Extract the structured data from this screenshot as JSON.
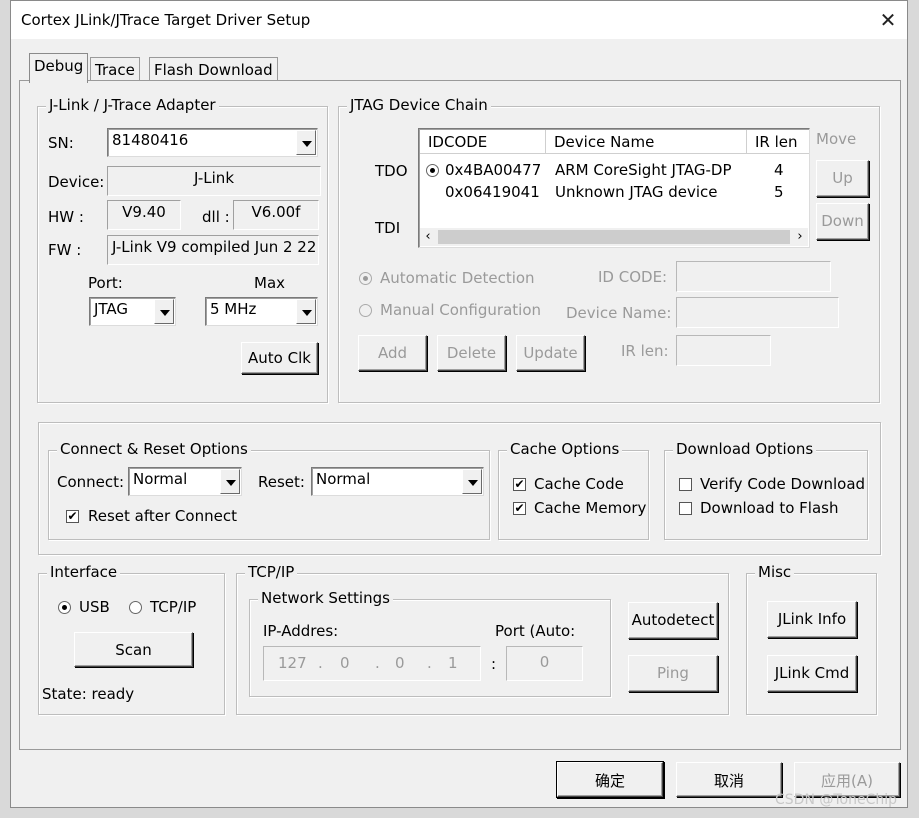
{
  "window": {
    "title": "Cortex JLink/JTrace Target Driver Setup"
  },
  "tabs": [
    "Debug",
    "Trace",
    "Flash Download"
  ],
  "adapter": {
    "group_title": "J-Link / J-Trace Adapter",
    "sn_label": "SN:",
    "sn_value": "81480416",
    "device_label": "Device:",
    "device_value": "J-Link",
    "hw_label": "HW :",
    "hw_value": "V9.40",
    "dll_label": "dll :",
    "dll_value": "V6.00f",
    "fw_label": "FW :",
    "fw_value": "J-Link V9 compiled Jun  2 22",
    "port_label": "Port:",
    "port_value": "JTAG",
    "max_label": "Max",
    "max_value": "5 MHz",
    "auto_clk": "Auto Clk"
  },
  "jtag": {
    "group_title": "JTAG Device Chain",
    "columns": [
      "IDCODE",
      "Device Name",
      "IR len"
    ],
    "rows": [
      {
        "idcode": "0x4BA00477",
        "name": "ARM CoreSight JTAG-DP",
        "irlen": "4"
      },
      {
        "idcode": "0x06419041",
        "name": "Unknown JTAG device",
        "irlen": "5"
      }
    ],
    "tdo": "TDO",
    "tdi": "TDI",
    "move_label": "Move",
    "up": "Up",
    "down": "Down",
    "auto_detect": "Automatic Detection",
    "manual_config": "Manual Configuration",
    "idcode_label": "ID CODE:",
    "devname_label": "Device Name:",
    "irlen_label": "IR len:",
    "add": "Add",
    "delete": "Delete",
    "update": "Update"
  },
  "connect": {
    "group_title": "Connect & Reset Options",
    "connect_label": "Connect:",
    "connect_value": "Normal",
    "reset_label": "Reset:",
    "reset_value": "Normal",
    "reset_after_connect": "Reset after Connect"
  },
  "cache": {
    "group_title": "Cache Options",
    "cache_code": "Cache Code",
    "cache_memory": "Cache Memory"
  },
  "download": {
    "group_title": "Download Options",
    "verify": "Verify Code Download",
    "to_flash": "Download to Flash"
  },
  "interface": {
    "group_title": "Interface",
    "usb": "USB",
    "tcpip": "TCP/IP",
    "scan": "Scan",
    "state": "State: ready"
  },
  "tcpip": {
    "group_title": "TCP/IP",
    "network_title": "Network Settings",
    "ip_label": "IP-Addres:",
    "ip": [
      "127",
      "0",
      "0",
      "1"
    ],
    "port_label": "Port (Auto:",
    "port_value": "0",
    "autodetect": "Autodetect",
    "ping": "Ping"
  },
  "misc": {
    "group_title": "Misc",
    "jlink_info": "JLink Info",
    "jlink_cmd": "JLink Cmd"
  },
  "footer": {
    "ok": "确定",
    "cancel": "取消",
    "apply": "应用(A)"
  },
  "watermark": "CSDN @ToneChip"
}
